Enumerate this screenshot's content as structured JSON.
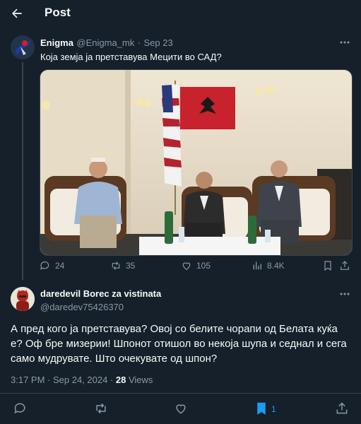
{
  "header": {
    "title": "Post"
  },
  "tweet": {
    "author_name": "Enigma",
    "author_handle": "@Enigma_mk",
    "separator": "·",
    "date": "Sep 23",
    "text": "Која земја ја претставува Мецити во САД?",
    "stats": {
      "replies": "24",
      "reposts": "35",
      "likes": "105",
      "views": "8.4K"
    }
  },
  "reply": {
    "author_name": "daredevil Borec za vistinata",
    "author_handle": "@daredev75426370",
    "text": "А пред кого ја претставува? Овој со белите чорапи од Белата куќа е? Оф бре мизерии! Шпонот отишол во некоја шупа и седнал и сега само мудрувате. Што очекувате од шпон?",
    "time": "3:17 PM · Sep 24, 2024 · ",
    "views_count": "28",
    "views_label": " Views",
    "bookmarks": "1"
  },
  "colors": {
    "background": "#15202b",
    "text": "#f7f9f9",
    "muted": "#8b98a5",
    "accent": "#1d9bf0",
    "border": "#38444d"
  },
  "icons": [
    "back-arrow-icon",
    "more-icon",
    "reply-icon",
    "repost-icon",
    "like-icon",
    "views-icon",
    "bookmark-icon",
    "share-icon"
  ]
}
